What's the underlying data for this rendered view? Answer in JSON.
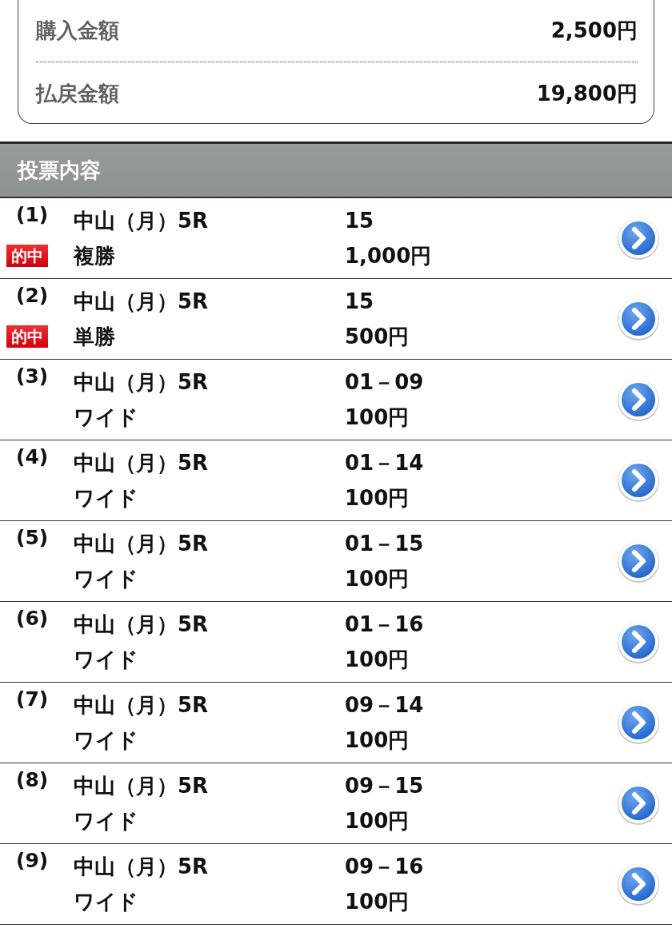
{
  "summary": [
    {
      "label": "購入金額",
      "value": "2,500円"
    },
    {
      "label": "払戻金額",
      "value": "19,800円"
    }
  ],
  "section_title": "投票内容",
  "bets": [
    {
      "number": "(1)",
      "race": "中山（月）5R",
      "type": "複勝",
      "selection": "15",
      "amount": "1,000円",
      "badge": "的中"
    },
    {
      "number": "(2)",
      "race": "中山（月）5R",
      "type": "単勝",
      "selection": "15",
      "amount": "500円",
      "badge": "的中"
    },
    {
      "number": "(3)",
      "race": "中山（月）5R",
      "type": "ワイド",
      "selection": "01－09",
      "amount": "100円"
    },
    {
      "number": "(4)",
      "race": "中山（月）5R",
      "type": "ワイド",
      "selection": "01－14",
      "amount": "100円"
    },
    {
      "number": "(5)",
      "race": "中山（月）5R",
      "type": "ワイド",
      "selection": "01－15",
      "amount": "100円"
    },
    {
      "number": "(6)",
      "race": "中山（月）5R",
      "type": "ワイド",
      "selection": "01－16",
      "amount": "100円"
    },
    {
      "number": "(7)",
      "race": "中山（月）5R",
      "type": "ワイド",
      "selection": "09－14",
      "amount": "100円"
    },
    {
      "number": "(8)",
      "race": "中山（月）5R",
      "type": "ワイド",
      "selection": "09－15",
      "amount": "100円"
    },
    {
      "number": "(9)",
      "race": "中山（月）5R",
      "type": "ワイド",
      "selection": "09－16",
      "amount": "100円"
    }
  ]
}
